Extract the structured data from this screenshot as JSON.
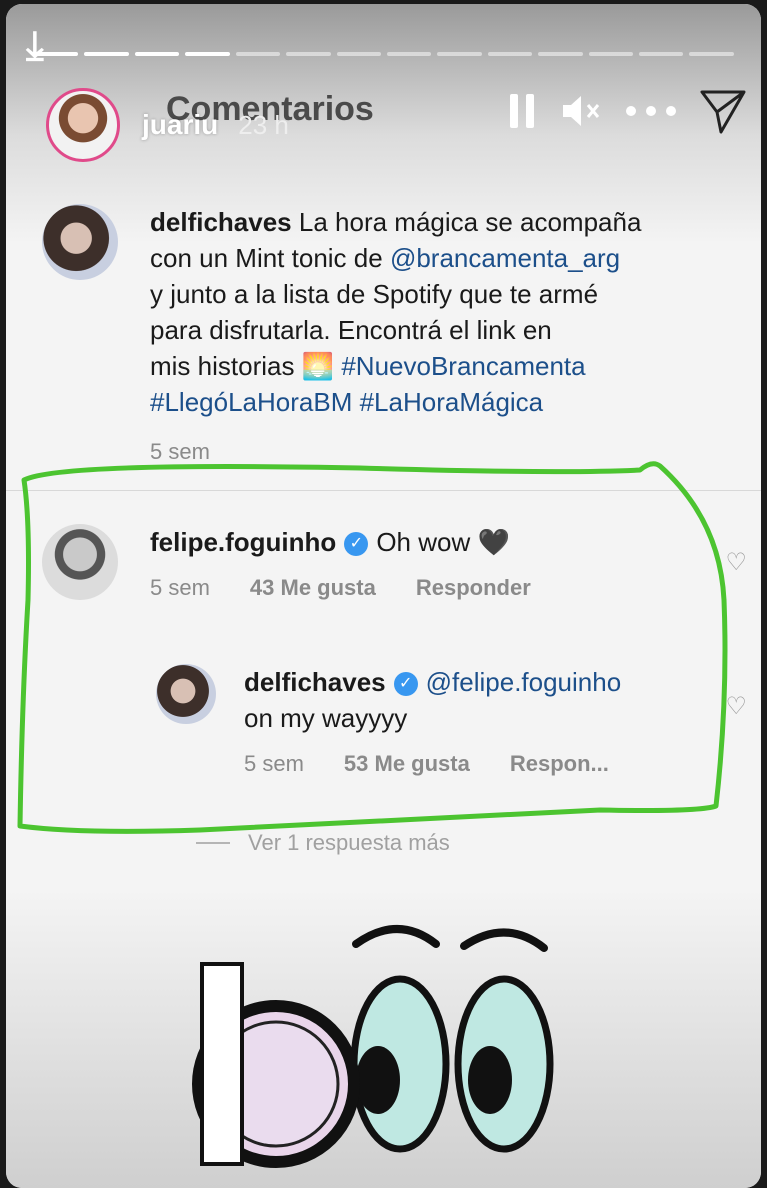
{
  "story": {
    "username": "juariu",
    "time": "23 h",
    "overlay_title": "Comentarios"
  },
  "icons": {
    "back": "arrow-down-icon",
    "pause": "pause-icon",
    "mute": "mute-icon",
    "more": "more-icon",
    "send": "send-icon"
  },
  "caption": {
    "username": "delfichaves",
    "text_1": "La hora mágica se acompaña",
    "text_2": "con un Mint tonic de",
    "mention": "@brancamenta_arg",
    "text_3": "y junto a la lista de Spotify que te armé",
    "text_4": "para disfrutarla. Encontrá el link en",
    "text_5": "mis historias",
    "emoji": "🌅",
    "hashtag_1": "#NuevoBrancamenta",
    "hashtag_2": "#LlegóLaHoraBM",
    "hashtag_3": "#LaHoraMágica",
    "time": "5 sem"
  },
  "comments": [
    {
      "username": "felipe.foguinho",
      "text": "Oh wow",
      "emoji": "🖤",
      "time": "5 sem",
      "likes": "43 Me gusta",
      "reply": "Responder"
    },
    {
      "username": "delfichaves",
      "mention": "@felipe.foguinho",
      "text": "on my wayyyy",
      "time": "5 sem",
      "likes": "53 Me gusta",
      "reply": "Respon..."
    }
  ],
  "more_replies": "Ver 1 respuesta más",
  "colors": {
    "highlight": "#4cc430",
    "link": "#1c4f8a",
    "verified": "#3897f0"
  }
}
